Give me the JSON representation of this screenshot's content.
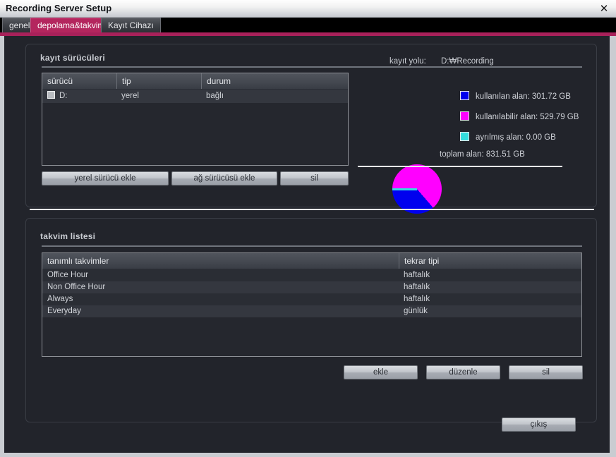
{
  "window": {
    "title": "Recording Server Setup",
    "close_icon": "close-icon",
    "close_glyph": "✕",
    "accent_color": "#a8215a"
  },
  "tabs": [
    {
      "label": "genel",
      "active": false
    },
    {
      "label": "depolama&takvim",
      "active": true
    },
    {
      "label": "Kayıt Cihazı",
      "active": false
    }
  ],
  "storage_section": {
    "title": "kayıt sürücüleri",
    "table": {
      "headers": [
        "sürücü",
        "tip",
        "durum"
      ],
      "rows": [
        {
          "checked": false,
          "drive": "D:",
          "type": "yerel",
          "status": "bağlı"
        }
      ]
    },
    "buttons": {
      "add_local": "yerel sürücü ekle",
      "add_network": "ağ sürücüsü ekle",
      "delete": "sil"
    }
  },
  "disk_info": {
    "path_label": "kayıt yolu:",
    "path_value": "D:₩Recording",
    "total_label": "toplam alan: 831.51 GB",
    "legend": [
      {
        "label": "kullanılan alan: 301.72 GB",
        "color": "#0000ee"
      },
      {
        "label": "kullanılabilir alan: 529.79 GB",
        "color": "#ff00ff"
      },
      {
        "label": "ayrılmış alan: 0.00 GB",
        "color": "#33dddd"
      }
    ]
  },
  "chart_data": {
    "type": "pie",
    "title": "",
    "categories": [
      "kullanılan alan",
      "kullanılabilir alan",
      "ayrılmış alan"
    ],
    "values": [
      301.72,
      529.79,
      0.0
    ],
    "unit": "GB",
    "total": 831.51,
    "percentages": [
      36.3,
      63.7,
      0.0
    ],
    "colors": [
      "#0000ee",
      "#ff00ff",
      "#33dddd"
    ],
    "legend_position": "right",
    "labels": [
      "kullanılan alan: 301.72 GB",
      "kullanılabilir alan: 529.79 GB",
      "ayrılmış alan: 0.00 GB"
    ],
    "annotation": "toplam alan: 831.51 GB"
  },
  "schedule_section": {
    "title": "takvim listesi",
    "table": {
      "headers": [
        "tanımlı takvimler",
        "tekrar tipi"
      ],
      "rows": [
        {
          "name": "Office Hour",
          "repeat": "haftalık"
        },
        {
          "name": "Non Office Hour",
          "repeat": "haftalık"
        },
        {
          "name": "Always",
          "repeat": "haftalık"
        },
        {
          "name": "Everyday",
          "repeat": "günlük"
        }
      ]
    },
    "buttons": {
      "add": "ekle",
      "edit": "düzenle",
      "delete": "sil"
    }
  },
  "footer": {
    "exit": "çıkış"
  }
}
